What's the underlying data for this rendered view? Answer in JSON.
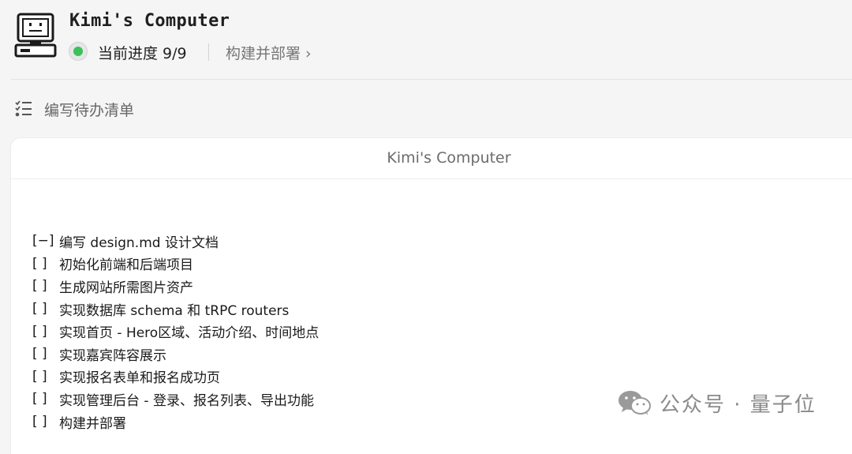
{
  "header": {
    "app_title": "Kimi's Computer",
    "progress_text": "当前进度 9/9",
    "current_step_link": "构建并部署 ›",
    "status_color": "#3cc05a"
  },
  "task": {
    "icon": "checklist-icon",
    "title": "编写待办清单"
  },
  "panel": {
    "title": "Kimi's Computer",
    "todos": [
      {
        "check": "[−]",
        "text": "编写 design.md 设计文档"
      },
      {
        "check": "[  ]",
        "text": "初始化前端和后端项目"
      },
      {
        "check": "[  ]",
        "text": "生成网站所需图片资产"
      },
      {
        "check": "[  ]",
        "text": "实现数据库 schema 和 tRPC routers"
      },
      {
        "check": "[  ]",
        "text": "实现首页 - Hero区域、活动介绍、时间地点"
      },
      {
        "check": "[  ]",
        "text": "实现嘉宾阵容展示"
      },
      {
        "check": "[  ]",
        "text": "实现报名表单和报名成功页"
      },
      {
        "check": "[  ]",
        "text": "实现管理后台 - 登录、报名列表、导出功能"
      },
      {
        "check": "[  ]",
        "text": "构建并部署"
      }
    ]
  },
  "watermark": {
    "icon": "wechat-icon",
    "text": "公众号 · 量子位"
  }
}
